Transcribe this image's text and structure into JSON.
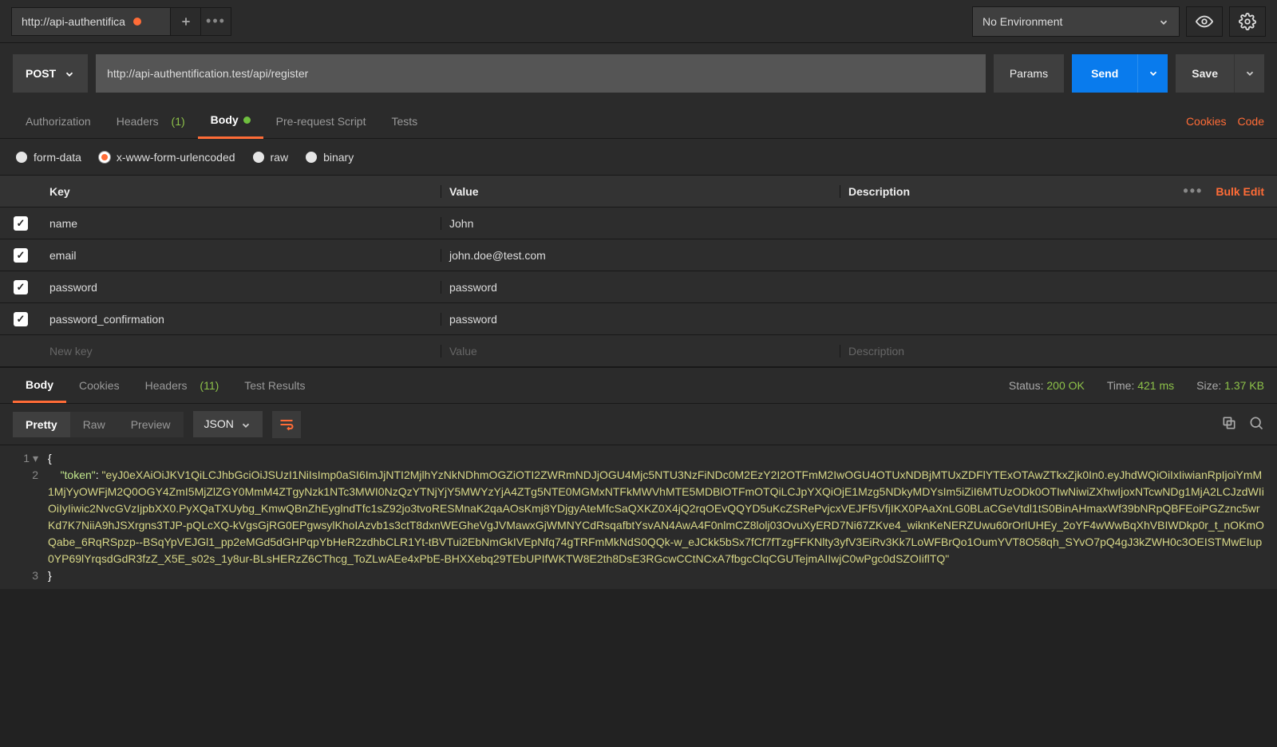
{
  "topbar": {
    "tab_title": "http://api-authentifica",
    "env_label": "No Environment"
  },
  "request": {
    "method": "POST",
    "url": "http://api-authentification.test/api/register",
    "params_label": "Params",
    "send_label": "Send",
    "save_label": "Save"
  },
  "tabs": {
    "authorization": "Authorization",
    "headers": "Headers",
    "headers_count": "(1)",
    "body": "Body",
    "prerequest": "Pre-request Script",
    "tests": "Tests",
    "cookies_link": "Cookies",
    "code_link": "Code"
  },
  "body_types": {
    "form_data": "form-data",
    "urlencoded": "x-www-form-urlencoded",
    "raw": "raw",
    "binary": "binary"
  },
  "params_table": {
    "headers": {
      "key": "Key",
      "value": "Value",
      "description": "Description"
    },
    "bulk_edit": "Bulk Edit",
    "rows": [
      {
        "checked": true,
        "key": "name",
        "value": "John",
        "description": ""
      },
      {
        "checked": true,
        "key": "email",
        "value": "john.doe@test.com",
        "description": ""
      },
      {
        "checked": true,
        "key": "password",
        "value": "password",
        "description": ""
      },
      {
        "checked": true,
        "key": "password_confirmation",
        "value": "password",
        "description": ""
      }
    ],
    "placeholder": {
      "key": "New key",
      "value": "Value",
      "description": "Description"
    }
  },
  "response": {
    "tabs": {
      "body": "Body",
      "cookies": "Cookies",
      "headers": "Headers",
      "headers_count": "(11)",
      "test_results": "Test Results"
    },
    "meta": {
      "status_label": "Status:",
      "status_value": "200 OK",
      "time_label": "Time:",
      "time_value": "421 ms",
      "size_label": "Size:",
      "size_value": "1.37 KB"
    },
    "view": {
      "pretty": "Pretty",
      "raw": "Raw",
      "preview": "Preview",
      "format": "JSON"
    },
    "json": {
      "line1": "{",
      "line2_key": "\"token\"",
      "line2_val": "\"eyJ0eXAiOiJKV1QiLCJhbGciOiJSUzI1NiIsImp0aSI6ImJjNTI2MjlhYzNkNDhmOGZiOTI2ZWRmNDJjOGU4Mjc5NTU3NzFiNDc0M2EzY2I2OTFmM2IwOGU4OTUxNDBjMTUxZDFlYTExOTAwZTkxZjk0In0.eyJhdWQiOiIxIiwianRpIjoiYmM1MjYyOWFjM2Q0OGY4ZmI5MjZlZGY0MmM4ZTgyNzk1NTc3MWI0NzQzYTNjYjY5MWYzYjA4ZTg5NTE0MGMxNTFkMWVhMTE5MDBlOTFmOTQiLCJpYXQiOjE1Mzg5NDkyMDYsIm5iZiI6MTUzODk0OTIwNiwiZXhwIjoxNTcwNDg1MjA2LCJzdWIiOiIyIiwic2NvcGVzIjpbXX0.PyXQaTXUybg_KmwQBnZhEyglndTfc1sZ92jo3tvoRESMnaK2qaAOsKmj8YDjgyAteMfcSaQXKZ0X4jQ2rqOEvQQYD5uKcZSRePvjcxVEJFf5VfjIKX0PAaXnLG0BLaCGeVtdl1tS0BinAHmaxWf39bNRpQBFEoiPGZznc5wrKd7K7NiiA9hJSXrgns3TJP-pQLcXQ-kVgsGjRG0EPgwsylKhoIAzvb1s3ctT8dxnWEGheVgJVMawxGjWMNYCdRsqafbtYsvAN4AwA4F0nlmCZ8lolj03OvuXyERD7Ni67ZKve4_wiknKeNERZUwu60rOrIUHEy_2oYF4wWwBqXhVBIWDkp0r_t_nOKmOQabe_6RqRSpzp--BSqYpVEJGl1_pp2eMGd5dGHPqpYbHeR2zdhbCLR1Yt-tBVTui2EbNmGkIVEpNfq74gTRFmMkNdS0QQk-w_eJCkk5bSx7fCf7fTzgFFKNlty3yfV3EiRv3Kk7LoWFBrQo1OumYVT8O58qh_SYvO7pQ4gJ3kZWH0c3OEISTMwEIup0YP69lYrqsdGdR3fzZ_X5E_s02s_1y8ur-BLsHERzZ6CThcg_ToZLwAEe4xPbE-BHXXebq29TEbUPIfWKTW8E2th8DsE3RGcwCCtNCxA7fbgcClqCGUTejmAIIwjC0wPgc0dSZOIiflTQ\"",
      "line3": "}"
    }
  }
}
